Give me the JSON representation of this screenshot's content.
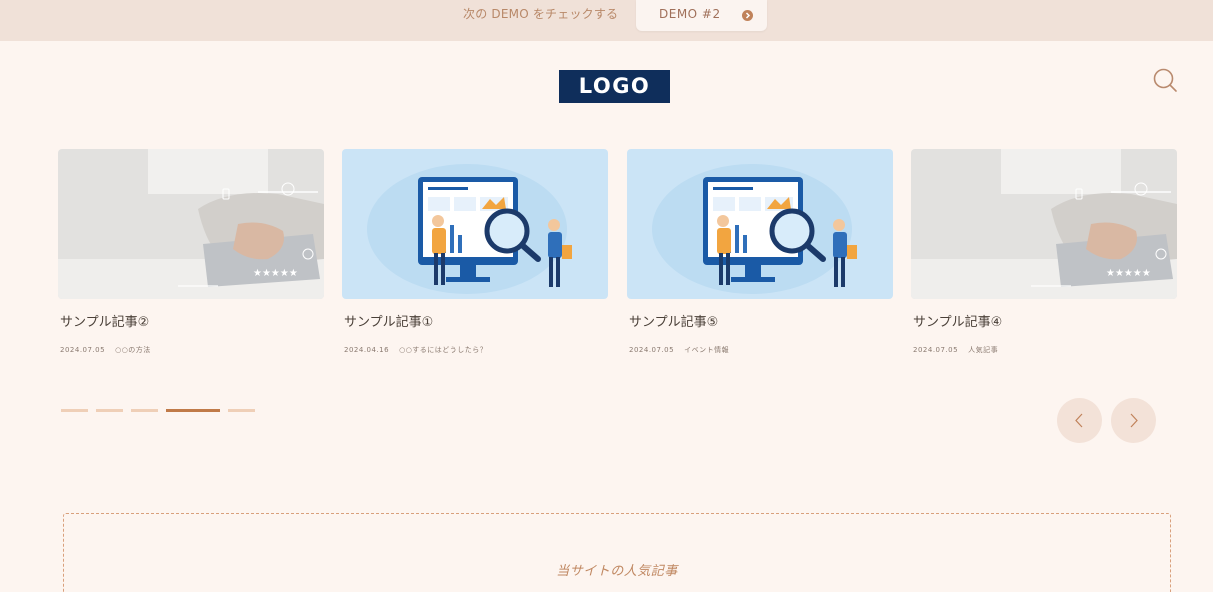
{
  "topbar": {
    "text": "次の DEMO をチェックする",
    "demo_button": "DEMO #2"
  },
  "header": {
    "logo": "LOGO",
    "search_icon": "search-icon"
  },
  "slider": {
    "cards": [
      {
        "title": "サンプル記事②",
        "date": "2024.07.05",
        "category": "○○の方法",
        "image": "laptop-hands-photo"
      },
      {
        "title": "サンプル記事①",
        "date": "2024.04.16",
        "category": "○○するにはどうしたら？",
        "image": "data-analysis-illustration"
      },
      {
        "title": "サンプル記事⑤",
        "date": "2024.07.05",
        "category": "イベント情報",
        "image": "data-analysis-illustration"
      },
      {
        "title": "サンプル記事④",
        "date": "2024.07.05",
        "category": "人気記事",
        "image": "laptop-hands-photo"
      }
    ],
    "pagination_count": 5,
    "active_page": 4,
    "prev_icon": "chevron-left-icon",
    "next_icon": "chevron-right-icon"
  },
  "popular": {
    "title": "当サイトの人気記事"
  },
  "colors": {
    "accent": "#c07a48",
    "logo_bg": "#0f2e5b",
    "background": "#fdf5f0",
    "topbar_bg": "#f0e1d8"
  }
}
